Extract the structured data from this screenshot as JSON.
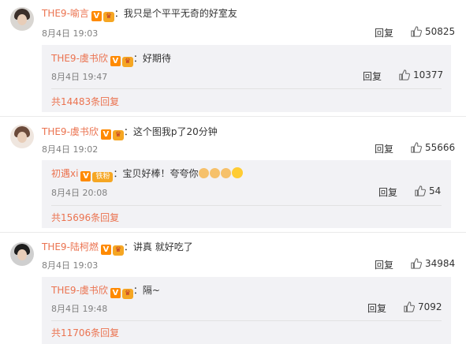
{
  "comments": [
    {
      "username": "THE9-喻言",
      "text": "：我只是个平平无奇的好室友",
      "date": "8月4日 19:03",
      "reply_label": "回复",
      "likes": "50825",
      "sub": {
        "username": "THE9-虞书欣",
        "text": "：好期待",
        "date": "8月4日 19:47",
        "reply_label": "回复",
        "likes": "10377",
        "more": "共14483条回复"
      }
    },
    {
      "username": "THE9-虞书欣",
      "text": "：这个图我p了20分钟",
      "date": "8月4日 19:02",
      "reply_label": "回复",
      "likes": "55666",
      "sub": {
        "username": "初遇xi",
        "fan_badge": "铁粉",
        "text": "：宝贝好棒！夸夸你",
        "date": "8月4日 20:08",
        "reply_label": "回复",
        "likes": "54",
        "more": "共15696条回复"
      }
    },
    {
      "username": "THE9-陆柯燃",
      "text": "：讲真 就好吃了",
      "date": "8月4日 19:03",
      "reply_label": "回复",
      "likes": "34984",
      "sub": {
        "username": "THE9-虞书欣",
        "text": "：隔~",
        "date": "8月4日 19:48",
        "reply_label": "回复",
        "likes": "7092",
        "more": "共11706条回复"
      }
    }
  ],
  "badges": {
    "v": "V",
    "crown": "♛"
  },
  "colors": {
    "username": "#eb7350",
    "badge_v": "#ff8a00",
    "subbox_bg": "#f2f2f5"
  },
  "icons": {
    "like": "thumbs-up-icon"
  }
}
